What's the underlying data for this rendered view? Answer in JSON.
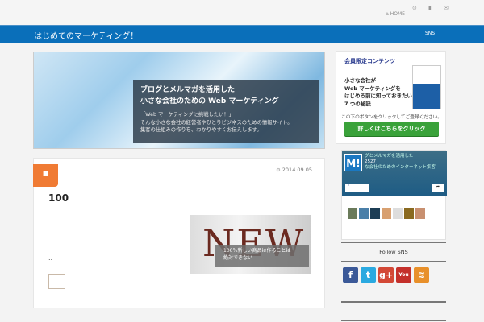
{
  "header": {
    "home_label": "HOME",
    "site_title": "はじめてのマーケティング！",
    "nav_sns": "SNS"
  },
  "hero": {
    "title_line1": "ブログとメルマガを活用した",
    "title_line2": "小さな会社のための Web マーケティング",
    "desc_line1": "「Web マーケティングに挑戦したい！」",
    "desc_line2": "そんな小さな会社の経営者やひとりビジネスのための情報サイト。",
    "desc_line3": "集客の仕組みの作りを、わかりやすくお伝えします。"
  },
  "post": {
    "date": "2014.09.05",
    "title": "100",
    "excerpt": "..",
    "thumb_word": "NEW",
    "thumb_caption_line1": "100％新しい商品は作ることは",
    "thumb_caption_line2": "絶対できない"
  },
  "sidebar": {
    "members": {
      "heading": "会員限定コンテンツ",
      "body_line1": "小さな会社が",
      "body_line2": "Web マーケティングを",
      "body_line3": "はじめる前に知っておきたい",
      "body_line4": "7 つの秘訣",
      "note": "この下のボタンをクリックしてご登録ください。",
      "button": "詳しくはこちらをクリック"
    },
    "facebook": {
      "logo": "M!",
      "page_name_line1": "グとメルマガを活用した",
      "likes": "2527",
      "page_name_line2": "な会社のためのインターネット集客"
    },
    "follow_title": "Follow SNS",
    "sns": [
      {
        "name": "facebook",
        "glyph": "f",
        "color": "#3b5998"
      },
      {
        "name": "twitter",
        "glyph": "t",
        "color": "#2aa9e0"
      },
      {
        "name": "google-plus",
        "glyph": "g+",
        "color": "#d34836"
      },
      {
        "name": "youtube",
        "glyph": "You",
        "color": "#c4302b"
      },
      {
        "name": "rss",
        "glyph": "≋",
        "color": "#e8902a"
      }
    ]
  }
}
